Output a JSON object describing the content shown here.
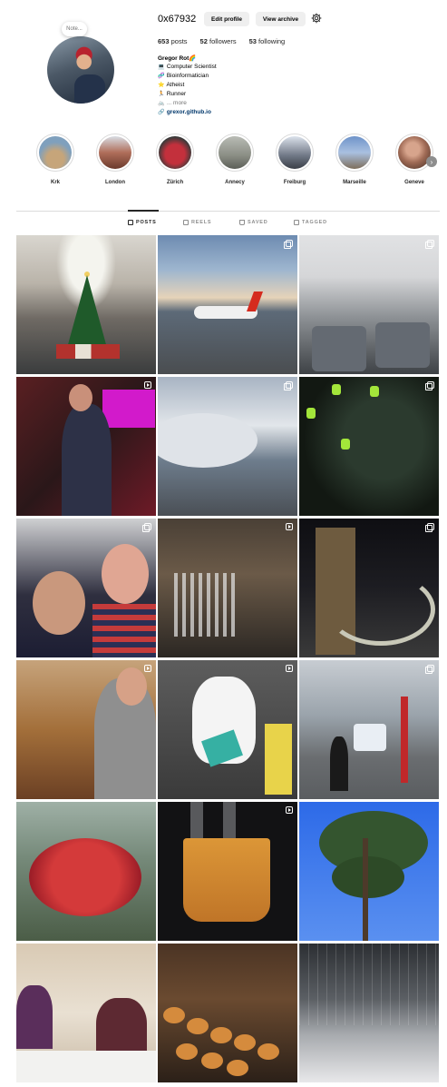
{
  "profile": {
    "username": "0x67932",
    "note_label": "Note...",
    "buttons": {
      "edit": "Edit profile",
      "archive": "View archive"
    },
    "stats": {
      "posts_count": "653",
      "posts_label": "posts",
      "followers_count": "52",
      "followers_label": "followers",
      "following_count": "53",
      "following_label": "following"
    },
    "bio": {
      "name": "Gregor Rot🌈",
      "lines": [
        {
          "icon": "💻",
          "text": "Computer Scientist"
        },
        {
          "icon": "🧬",
          "text": "Bioinformatician"
        },
        {
          "icon": "⭐",
          "text": "Atheist"
        },
        {
          "icon": "🏃",
          "text": "Runner"
        }
      ],
      "more_icon": "🚲",
      "more": "... more",
      "link_icon": "🔗",
      "link": "grexor.github.io"
    }
  },
  "highlights": [
    {
      "label": "Krk",
      "color": "#7fa0bd"
    },
    {
      "label": "London",
      "color": "#b06e5a"
    },
    {
      "label": "Zürich",
      "color": "#c3303c"
    },
    {
      "label": "Annecy",
      "color": "#8a8d84"
    },
    {
      "label": "Freiburg",
      "color": "#6f7785"
    },
    {
      "label": "Marseille",
      "color": "#6e93c9"
    },
    {
      "label": "Geneve",
      "color": "#9f6a55"
    }
  ],
  "tabs": [
    {
      "label": "POSTS",
      "active": true
    },
    {
      "label": "REELS",
      "active": false
    },
    {
      "label": "SAVED",
      "active": false
    },
    {
      "label": "TAGGED",
      "active": false
    }
  ],
  "posts": [
    {
      "badge": "none"
    },
    {
      "badge": "multi"
    },
    {
      "badge": "multi"
    },
    {
      "badge": "reel"
    },
    {
      "badge": "multi"
    },
    {
      "badge": "multi"
    },
    {
      "badge": "multi"
    },
    {
      "badge": "reel"
    },
    {
      "badge": "multi"
    },
    {
      "badge": "reel"
    },
    {
      "badge": "reel"
    },
    {
      "badge": "multi"
    },
    {
      "badge": "none"
    },
    {
      "badge": "reel"
    },
    {
      "badge": "none"
    },
    {
      "badge": "none"
    },
    {
      "badge": "none"
    },
    {
      "badge": "none"
    }
  ]
}
